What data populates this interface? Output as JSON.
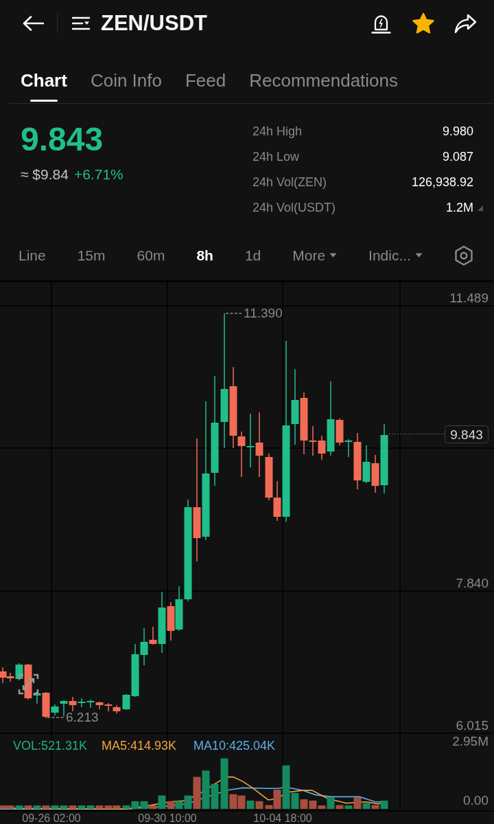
{
  "header": {
    "title": "ZEN/USDT",
    "favorite": true
  },
  "tabs": [
    {
      "label": "Chart",
      "selected": true
    },
    {
      "label": "Coin Info",
      "selected": false
    },
    {
      "label": "Feed",
      "selected": false
    },
    {
      "label": "Recommendations",
      "selected": false
    }
  ],
  "ticker": {
    "price": "9.843",
    "fiat_price": "≈ $9.84",
    "change": "+6.71%"
  },
  "stats": [
    {
      "label": "24h High",
      "value": "9.980",
      "kind": "plain"
    },
    {
      "label": "24h Low",
      "value": "9.087",
      "kind": "plain"
    },
    {
      "label": "24h Vol(ZEN)",
      "value": "126,938.92",
      "kind": "plain"
    },
    {
      "label": "24h Vol(USDT)",
      "value": "1.2M",
      "kind": "switchable"
    }
  ],
  "intervals": [
    {
      "label": "Line",
      "selected": false,
      "kind": "option"
    },
    {
      "label": "15m",
      "selected": false,
      "kind": "option"
    },
    {
      "label": "60m",
      "selected": false,
      "kind": "option"
    },
    {
      "label": "8h",
      "selected": true,
      "kind": "option"
    },
    {
      "label": "1d",
      "selected": false,
      "kind": "option"
    },
    {
      "label": "More",
      "selected": false,
      "kind": "dropdown"
    },
    {
      "label": "Indic...",
      "selected": false,
      "kind": "dropdown"
    }
  ],
  "chart": {
    "price_axis": [
      "11.489",
      "7.840",
      "6.015"
    ],
    "current_price": "9.843",
    "high_marker": "11.390",
    "low_marker": "6.213",
    "volume_legend": [
      {
        "label": "VOL:521.31K",
        "color": "#20b583"
      },
      {
        "label": "MA5:414.93K",
        "color": "#f2a53c"
      },
      {
        "label": "MA10:425.04K",
        "color": "#5cb0ea"
      }
    ],
    "volume_axis": [
      "2.95M",
      "0.00"
    ],
    "time_axis": [
      "09-26 02:00",
      "09-30 10:00",
      "10-04 18:00"
    ]
  }
}
